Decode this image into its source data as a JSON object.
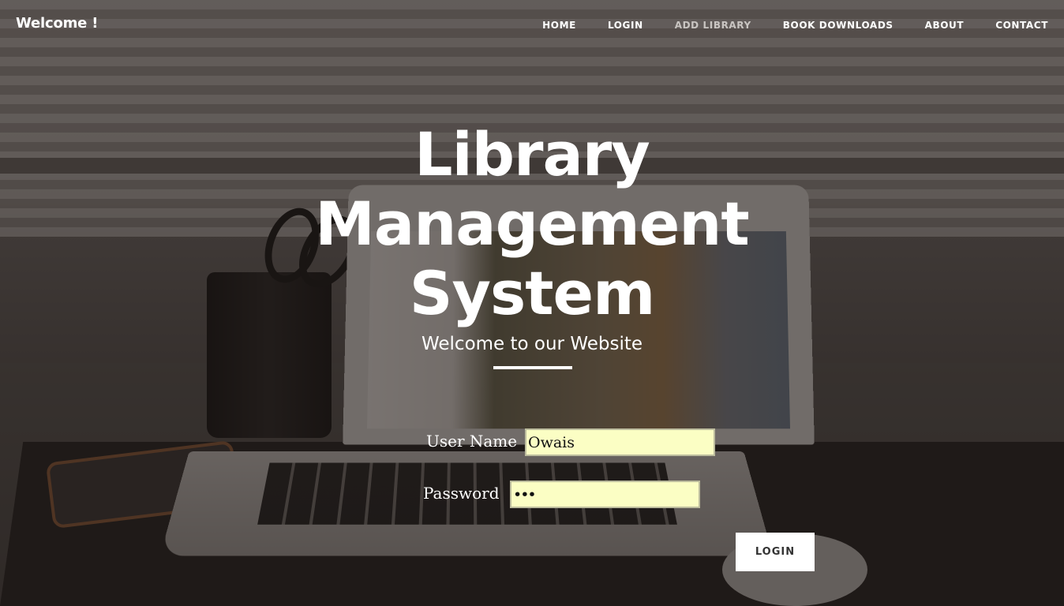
{
  "brand": {
    "text": "Welcome !"
  },
  "nav": {
    "items": [
      {
        "label": "HOME"
      },
      {
        "label": "LOGIN"
      },
      {
        "label": "ADD LIBRARY"
      },
      {
        "label": "BOOK DOWNLOADS"
      },
      {
        "label": "ABOUT"
      },
      {
        "label": "CONTACT"
      }
    ],
    "active_color": "#c9c5c2"
  },
  "hero": {
    "title_line1": "Library",
    "title_line2": "Management",
    "title_line3": "System",
    "subtitle": "Welcome to our Website"
  },
  "form": {
    "username_label": "User Name",
    "username_value": "Owais",
    "password_label": "Password",
    "password_value": "•••",
    "input_background": "#fbfec4",
    "submit_label": "LOGIN"
  }
}
